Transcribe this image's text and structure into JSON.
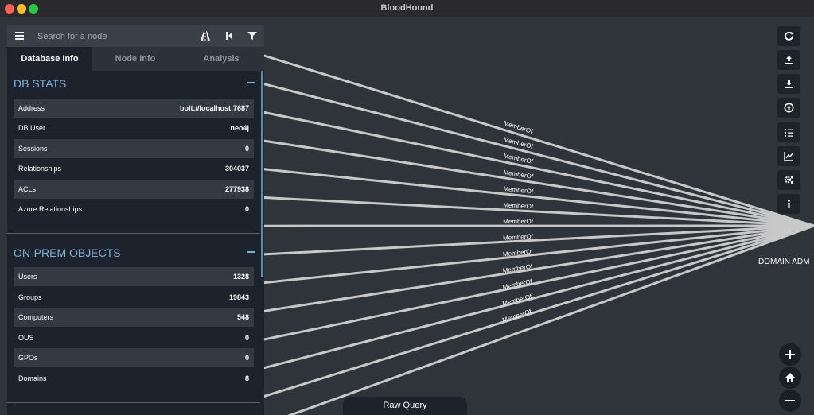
{
  "window": {
    "title": "BloodHound"
  },
  "search": {
    "placeholder": "Search for a node"
  },
  "tabs": [
    {
      "label": "Database Info",
      "active": true
    },
    {
      "label": "Node Info",
      "active": false
    },
    {
      "label": "Analysis",
      "active": false
    }
  ],
  "db_stats": {
    "title": "DB STATS",
    "rows": [
      {
        "label": "Address",
        "value": "bolt://localhost:7687"
      },
      {
        "label": "DB User",
        "value": "neo4j"
      },
      {
        "label": "Sessions",
        "value": "0"
      },
      {
        "label": "Relationships",
        "value": "304037"
      },
      {
        "label": "ACLs",
        "value": "277938"
      },
      {
        "label": "Azure Relationships",
        "value": "0"
      }
    ]
  },
  "onprem": {
    "title": "ON-PREM OBJECTS",
    "rows": [
      {
        "label": "Users",
        "value": "1328"
      },
      {
        "label": "Groups",
        "value": "19843"
      },
      {
        "label": "Computers",
        "value": "548"
      },
      {
        "label": "OUS",
        "value": "0"
      },
      {
        "label": "GPOs",
        "value": "0"
      },
      {
        "label": "Domains",
        "value": "8"
      }
    ]
  },
  "graph": {
    "target_label": "DOMAIN ADM",
    "edge_labels": [
      "MemberOf",
      "MemberOf",
      "MemberOf",
      "MemberOf",
      "MemberOf",
      "MemberOf",
      "MemberOf",
      "MemberOf",
      "MemberOf",
      "MemberOf",
      "MemberOf",
      "MemberOf",
      "MemberOf"
    ],
    "edge_color": "#c8c8c8",
    "node_color": "#17b217"
  },
  "toolbar": {
    "icons": [
      "refresh-icon",
      "upload-icon",
      "download-icon",
      "upload-circle-icon",
      "list-icon",
      "chart-icon",
      "settings-icon",
      "info-icon"
    ]
  },
  "zoom": {
    "icons": [
      "zoom-in-icon",
      "home-icon",
      "zoom-out-icon"
    ]
  },
  "raw_query": {
    "label": "Raw Query"
  }
}
